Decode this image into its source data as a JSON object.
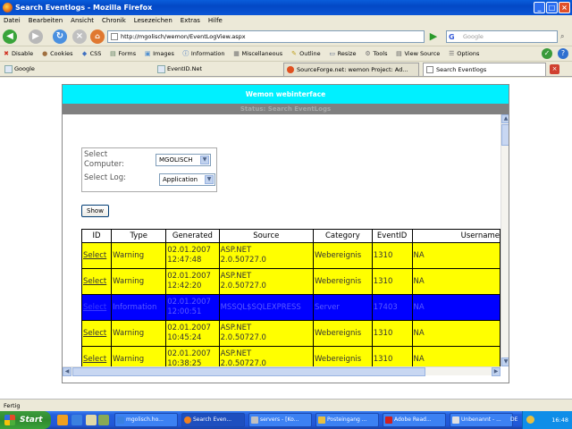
{
  "window": {
    "title": "Search Eventlogs - Mozilla Firefox"
  },
  "menu": [
    "Datei",
    "Bearbeiten",
    "Ansicht",
    "Chronik",
    "Lesezeichen",
    "Extras",
    "Hilfe"
  ],
  "navbar": {
    "url": "http://mgolisch/wemon/EventLogView.aspx",
    "search_placeholder": "Google"
  },
  "devbar": {
    "items": [
      "Disable",
      "Cookies",
      "CSS",
      "Forms",
      "Images",
      "Information",
      "Miscellaneous",
      "Outline",
      "Resize",
      "Tools",
      "View Source",
      "Options"
    ]
  },
  "bookmarks": [
    {
      "label": "Google"
    },
    {
      "label": "EventID.Net"
    }
  ],
  "tabs": [
    {
      "label": "SourceForge.net: wemon Project: Ad..."
    },
    {
      "label": "Search Eventlogs"
    }
  ],
  "page": {
    "header": "Wemon webinterface",
    "status": "Status: Search EventLogs",
    "computer_label_1": "Select",
    "computer_label_2": "Computer:",
    "computer_value": "MGOLISCH",
    "log_label": "Select Log:",
    "log_value": "Application",
    "show_button": "Show"
  },
  "table": {
    "headers": [
      "ID",
      "Type",
      "Generated",
      "Source",
      "Category",
      "EventID",
      "Username"
    ],
    "rows": [
      {
        "link": "Select",
        "type": "Warning",
        "gen1": "02.01.2007",
        "gen2": "12:47:48",
        "src1": "ASP.NET",
        "src2": "2.0.50727.0",
        "category": "Webereignis",
        "eventid": "1310",
        "username": "NA"
      },
      {
        "link": "Select",
        "type": "Warning",
        "gen1": "02.01.2007",
        "gen2": "12:42:20",
        "src1": "ASP.NET",
        "src2": "2.0.50727.0",
        "category": "Webereignis",
        "eventid": "1310",
        "username": "NA"
      },
      {
        "link": "Select",
        "type": "Information",
        "gen1": "02.01.2007",
        "gen2": "12:00:51",
        "src1": "MSSQL$SQLEXPRESS",
        "src2": "",
        "category": "Server",
        "eventid": "17403",
        "username": "NA"
      },
      {
        "link": "Select",
        "type": "Warning",
        "gen1": "02.01.2007",
        "gen2": "10:45:24",
        "src1": "ASP.NET",
        "src2": "2.0.50727.0",
        "category": "Webereignis",
        "eventid": "1310",
        "username": "NA"
      },
      {
        "link": "Select",
        "type": "Warning",
        "gen1": "02.01.2007",
        "gen2": "10:38:25",
        "src1": "ASP.NET",
        "src2": "2.0.50727.0",
        "category": "Webereignis",
        "eventid": "1310",
        "username": "NA"
      }
    ]
  },
  "statusbar": {
    "text": "Fertig"
  },
  "taskbar": {
    "start": "Start",
    "tasks": [
      "mgolisch.ho...",
      "Search Even...",
      "servers - [Ko...",
      "Posteingang ...",
      "Adobe Read...",
      "Unbenannt - ..."
    ],
    "lang": "DE",
    "clock": "16:48"
  }
}
